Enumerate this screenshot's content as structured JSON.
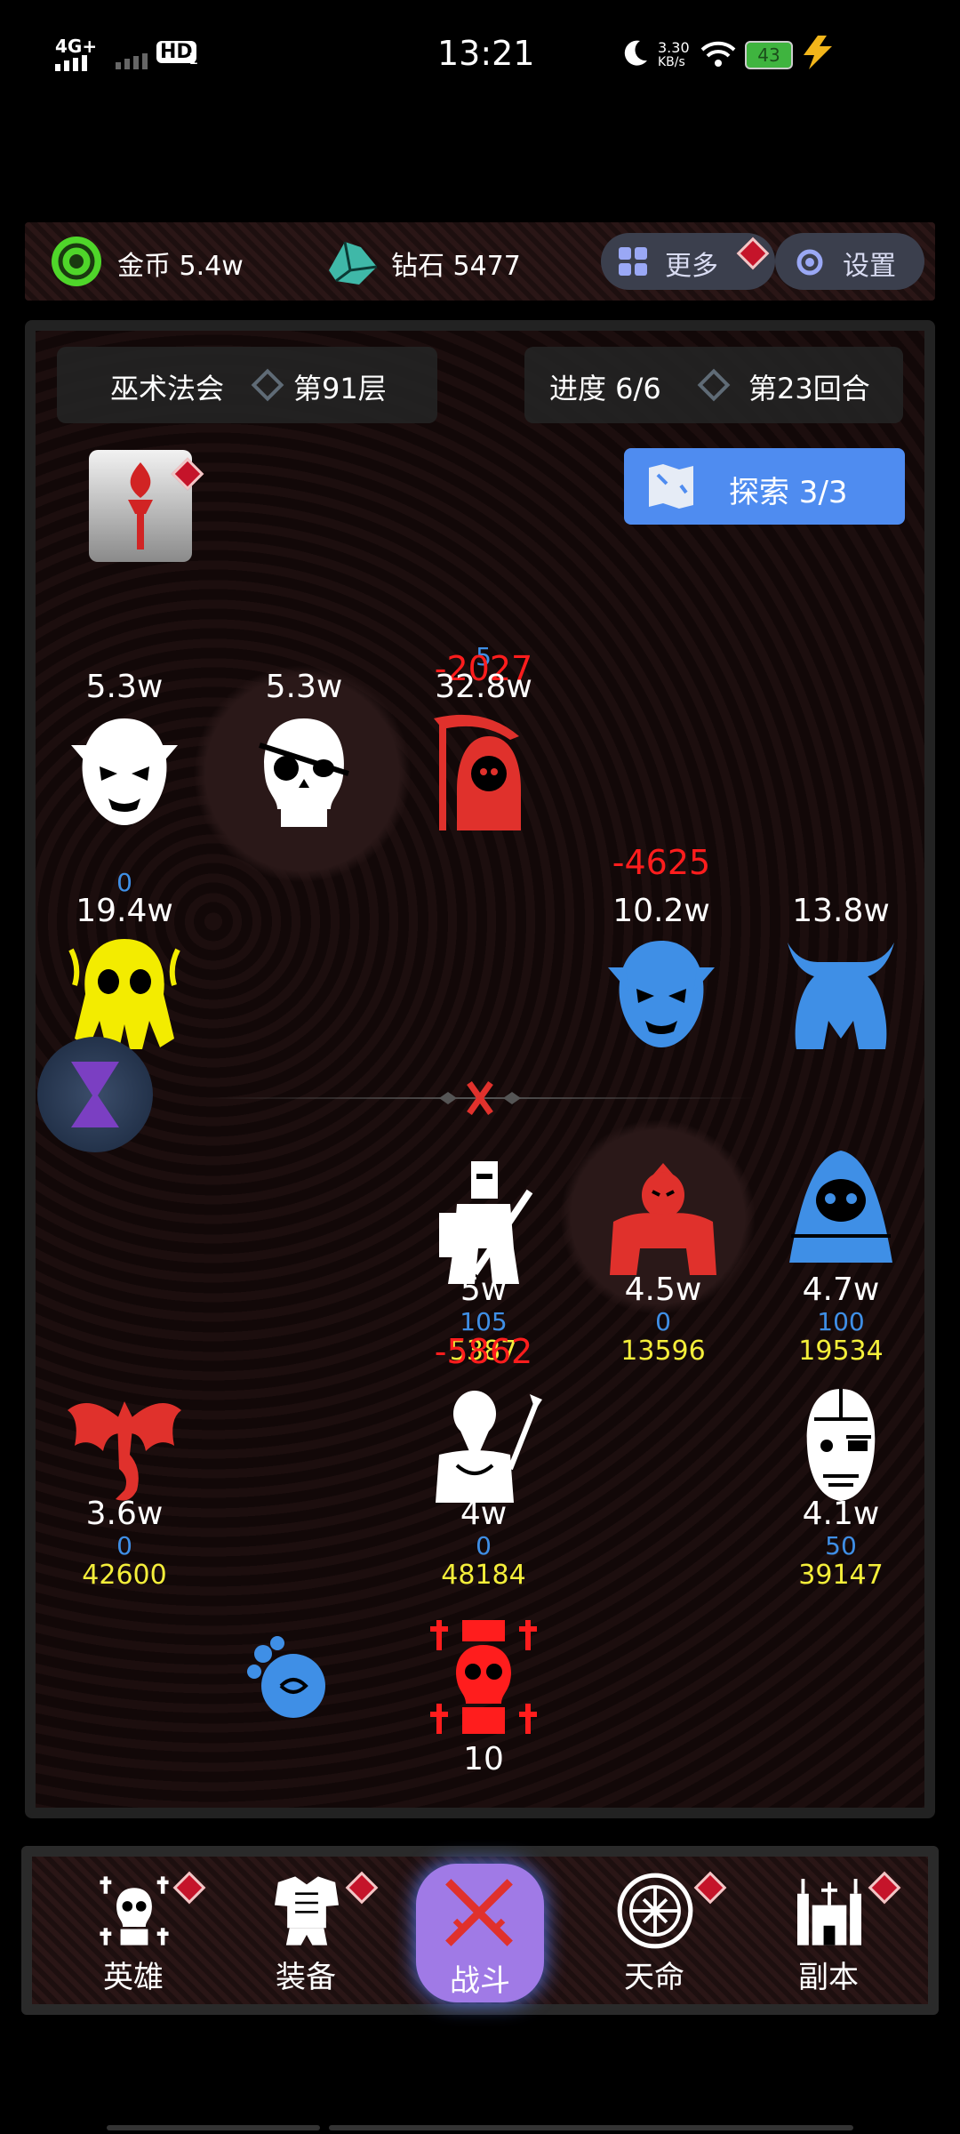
{
  "status_bar": {
    "network": "4G+",
    "hd": "HD",
    "sim": "1",
    "time": "13:21",
    "speed_value": "3.30",
    "speed_unit": "KB/s",
    "battery": "43"
  },
  "resources": {
    "gold_label": "金币 5.4w",
    "diamond_label": "钻石 5477",
    "more_button": "更多",
    "settings_button": "设置"
  },
  "stage": {
    "dungeon_name": "巫术法会",
    "floor": "第91层",
    "progress": "进度 6/6",
    "round": "第23回合",
    "explore_label": "探索 3/3"
  },
  "enemies": [
    {
      "hp": "5.3w",
      "icon": "vampire-face-icon",
      "color": "#ffffff"
    },
    {
      "hp": "5.3w",
      "icon": "pirate-skull-icon",
      "color": "#ffffff"
    },
    {
      "hp": "32.8w",
      "icon": "grim-reaper-icon",
      "color": "#e0312c",
      "shield": "5",
      "damage": "-2027"
    },
    {
      "hp": "19.4w",
      "icon": "cthulhu-skull-icon",
      "color": "#f3ec00",
      "shield": "0"
    },
    {
      "hp": "10.2w",
      "icon": "vampire-face-icon",
      "color": "#3f8fe6",
      "damage": "-4625"
    },
    {
      "hp": "13.8w",
      "icon": "horned-beast-icon",
      "color": "#3f8fe6"
    }
  ],
  "heroes": [
    {
      "hp": "5w",
      "shield": "105",
      "value": "5387",
      "damage": "-5862",
      "icon": "knight-icon",
      "color": "#ffffff"
    },
    {
      "hp": "4.5w",
      "shield": "0",
      "value": "13596",
      "icon": "brute-icon",
      "color": "#e0312c"
    },
    {
      "hp": "4.7w",
      "shield": "100",
      "value": "19534",
      "icon": "hooded-mystic-icon",
      "color": "#3f8fe6"
    },
    {
      "hp": "3.6w",
      "shield": "0",
      "value": "42600",
      "icon": "dragon-icon",
      "color": "#e0312c"
    },
    {
      "hp": "4w",
      "shield": "0",
      "value": "48184",
      "icon": "old-sage-icon",
      "color": "#ffffff"
    },
    {
      "hp": "4.1w",
      "shield": "50",
      "value": "39147",
      "icon": "cyborg-head-icon",
      "color": "#ffffff"
    }
  ],
  "totem": {
    "count": "10",
    "icon": "skull-totem-icon",
    "color": "#ff1d1d"
  },
  "nav": {
    "hero": "英雄",
    "equipment": "装备",
    "battle": "战斗",
    "fate": "天命",
    "dungeon": "副本"
  },
  "colors": {
    "accent_blue": "#4f8cf0",
    "battle_purple": "#a07ae6",
    "damage_red": "#ff1d1d",
    "shield_blue": "#3f8fe6",
    "value_yellow": "#f4ee3a"
  }
}
